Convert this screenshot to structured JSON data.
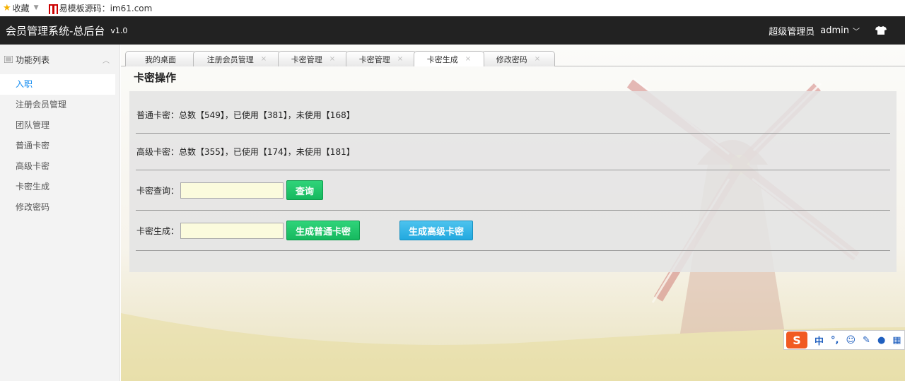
{
  "favorites": {
    "collect_label": "收藏",
    "site_label": "易模板源码：im61.com"
  },
  "header": {
    "title": "会员管理系统-总后台",
    "version": "v1.0",
    "role": "超级管理员",
    "user": "admin"
  },
  "sidebar": {
    "heading": "功能列表",
    "items": [
      {
        "label": "入职"
      },
      {
        "label": "注册会员管理"
      },
      {
        "label": "团队管理"
      },
      {
        "label": "普通卡密"
      },
      {
        "label": "高级卡密"
      },
      {
        "label": "卡密生成"
      },
      {
        "label": "修改密码"
      }
    ]
  },
  "tabs": [
    {
      "label": "我的桌面"
    },
    {
      "label": "注册会员管理",
      "close": "×"
    },
    {
      "label": "卡密管理",
      "close": "×"
    },
    {
      "label": "卡密管理",
      "close": "×"
    },
    {
      "label": "卡密生成",
      "close": "×"
    },
    {
      "label": "修改密码",
      "close": "×"
    }
  ],
  "panel": {
    "title": "卡密操作",
    "normal_stats": "普通卡密：总数【549】，已使用【381】，未使用【168】",
    "advanced_stats": "高级卡密：总数【355】，已使用【174】，未使用【181】",
    "query_label": "卡密查询：",
    "query_value": "",
    "query_button": "查询",
    "generate_label": "卡密生成：",
    "generate_value": "",
    "generate_normal_button": "生成普通卡密",
    "generate_advanced_button": "生成高级卡密"
  },
  "ime": {
    "mode": "中",
    "punct": "°,",
    "emoji": "☺"
  },
  "colors": {
    "header_bg": "#222222",
    "active_menu": "#148cf1",
    "green_button": "#16b85e",
    "blue_button": "#22a9df"
  }
}
